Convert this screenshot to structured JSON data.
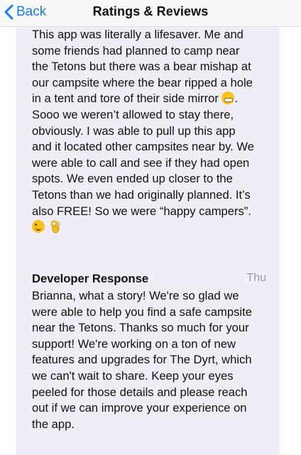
{
  "nav": {
    "back_label": "Back",
    "title": "Ratings & Reviews"
  },
  "review": {
    "lines": [
      "This app was literally a lifesaver. Me and",
      "some friends had planned to camp near",
      "the Tetons but there was a bear mishap at",
      "our campsite where the bear ripped a hole",
      "in a tent and tore of their side mirror",
      "Sooo we weren’t allowed to stay there,",
      "obviously. I was able to pull up this app",
      "and it located other campsites near by. We",
      "were able to call and see if they had open",
      "spots. We even ended up closer to the",
      "Tetons than we had originally planned. It’s",
      "also FREE! So we were “happy campers”."
    ],
    "line5_suffix": ".",
    "emojis": [
      "grimacing-face-emoji",
      "winking-face-emoji",
      "ok-hand-emoji"
    ]
  },
  "developer_response": {
    "label": "Developer Response",
    "date": "Thu",
    "lines": [
      "Brianna, what a story! We're so glad we",
      "were able to help you find a safe campsite",
      "near the Tetons. Thanks so much for your",
      "support! We're working on a ton of new",
      "features and upgrades for The Dyrt, which",
      "we can't wait to share. Keep your eyes",
      "peeled for those details and please reach",
      "out if we can improve your experience on",
      "the app."
    ]
  },
  "colors": {
    "accent": "#1a7cf5",
    "card_background": "#efeef6",
    "muted_text": "#9b9ba2"
  }
}
